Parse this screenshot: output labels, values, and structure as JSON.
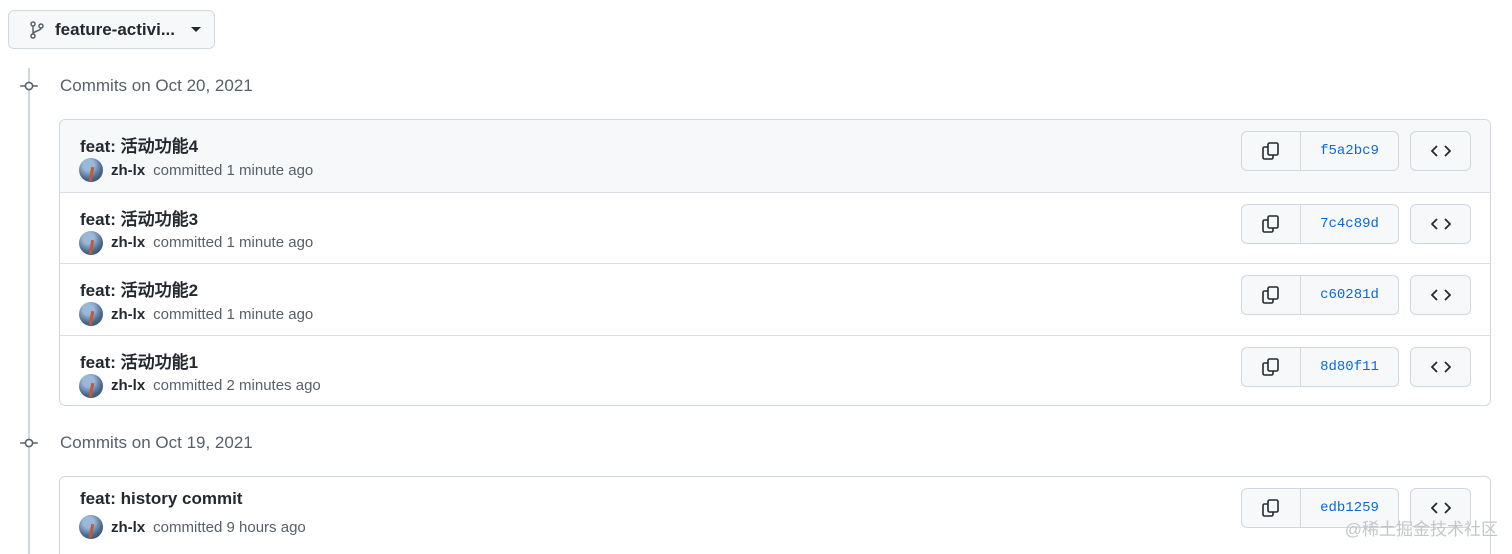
{
  "branch": {
    "label": "feature-activi..."
  },
  "groups": [
    {
      "title": "Commits on Oct 20, 2021",
      "commits": [
        {
          "message": "feat: 活动功能4",
          "author": "zh-lx",
          "committed": "committed 1 minute ago",
          "sha": "f5a2bc9"
        },
        {
          "message": "feat: 活动功能3",
          "author": "zh-lx",
          "committed": "committed 1 minute ago",
          "sha": "7c4c89d"
        },
        {
          "message": "feat: 活动功能2",
          "author": "zh-lx",
          "committed": "committed 1 minute ago",
          "sha": "c60281d"
        },
        {
          "message": "feat: 活动功能1",
          "author": "zh-lx",
          "committed": "committed 2 minutes ago",
          "sha": "8d80f11"
        }
      ]
    },
    {
      "title": "Commits on Oct 19, 2021",
      "commits": [
        {
          "message": "feat: history commit",
          "author": "zh-lx",
          "committed": "committed 9 hours ago",
          "sha": "edb1259"
        }
      ]
    }
  ],
  "watermark": "@稀土掘金技术社区",
  "icons": {
    "branch": "git-branch-icon",
    "commit": "git-commit-icon",
    "copy": "copy-icon",
    "browse": "code-icon"
  },
  "colors": {
    "link": "#0969da",
    "border": "#d0d7de",
    "muted": "#57606a"
  }
}
